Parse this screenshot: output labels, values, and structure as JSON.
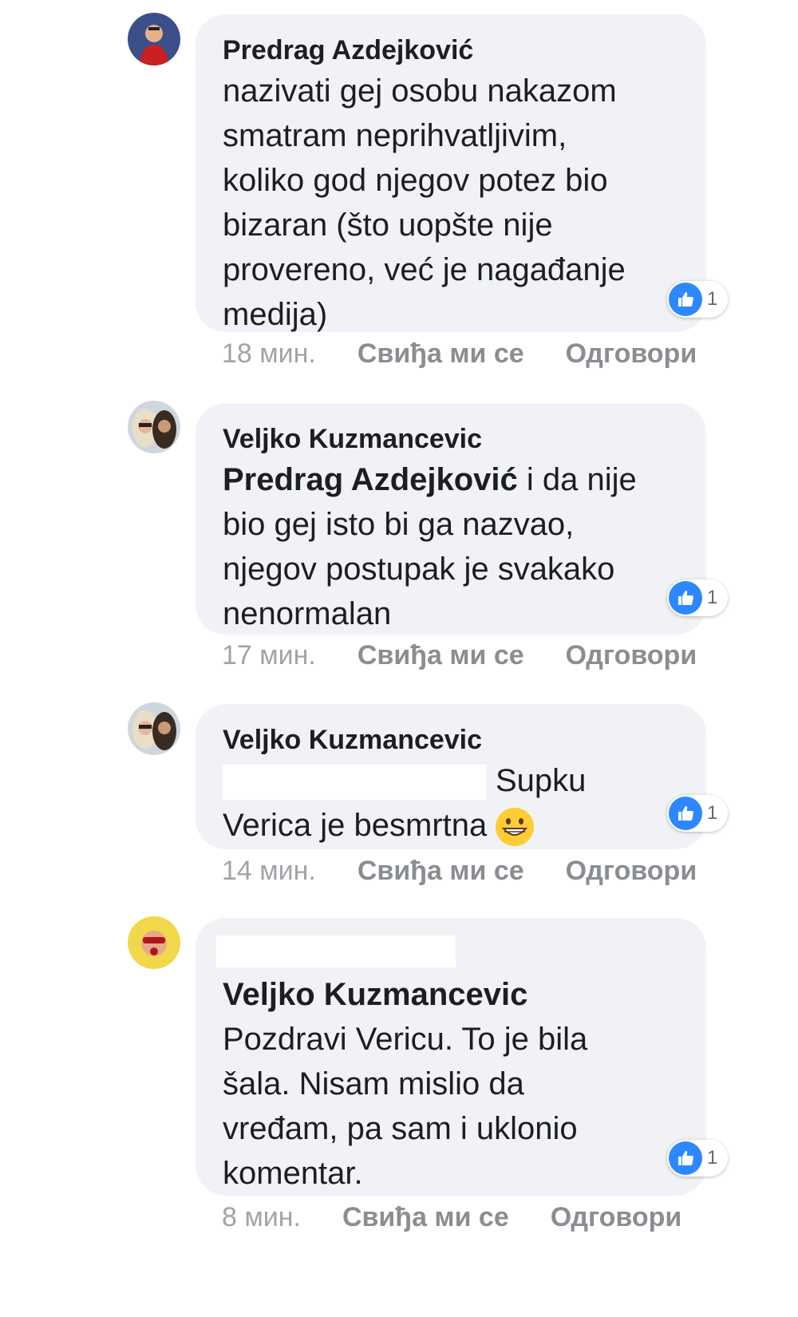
{
  "comments": [
    {
      "author": "Predrag Azdejković",
      "lines": [
        "nazivati gej osobu nakazom",
        "smatram neprihvatljivim,",
        "koliko god njegov potez bio",
        "bizaran (što uopšte nije",
        "provereno, već je nagađanje",
        "medija)"
      ],
      "reaction_count": "1",
      "time": "18 мин.",
      "like_label": "Свиђа ми се",
      "reply_label": "Одговори"
    },
    {
      "author": "Veljko Kuzmancevic",
      "mention": "Predrag Azdejković",
      "lines": [
        " i da nije",
        "bio gej isto bi ga nazvao,",
        "njegov postupak je svakako",
        "nenormalan"
      ],
      "reaction_count": "1",
      "time": "17 мин.",
      "like_label": "Свиђа ми се",
      "reply_label": "Одговори"
    },
    {
      "author": "Veljko Kuzmancevic",
      "lines": [
        "Supku",
        "Verica je besmrtna"
      ],
      "emoji": "grinning-face-emoji",
      "reaction_count": "1",
      "time": "14 мин.",
      "like_label": "Свиђа ми се",
      "reply_label": "Одговори"
    },
    {
      "mention": "Veljko Kuzmancevic",
      "lines": [
        "Pozdravi Vericu. To je bila",
        "šala. Nisam mislio da",
        "vređam, pa sam i uklonio",
        "komentar."
      ],
      "reaction_count": "1",
      "time": "8 мин.",
      "like_label": "Свиђа ми се",
      "reply_label": "Одговори"
    }
  ],
  "colors": {
    "bubble": "#f0f2f5",
    "like_blue": "#2d88ff",
    "meta_gray": "#8a8d91"
  }
}
